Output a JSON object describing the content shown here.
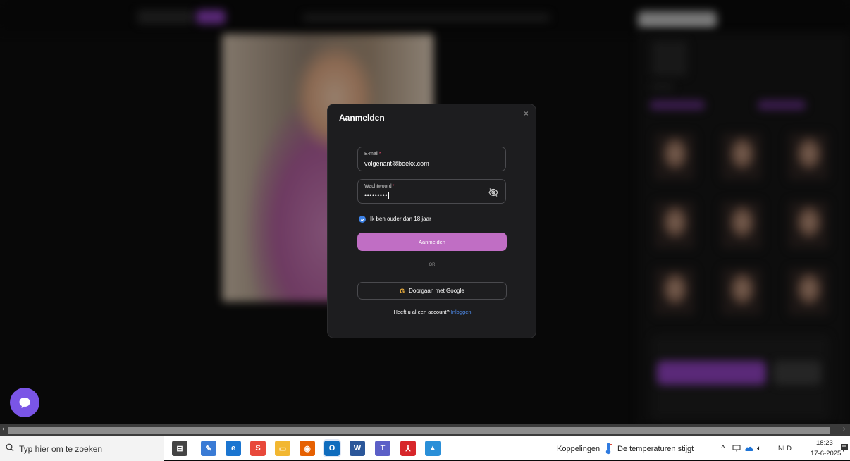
{
  "modal": {
    "title": "Aanmelden",
    "close_glyph": "×",
    "email_label": "E-mail",
    "email_required": "*",
    "email_value": "volgenant@boekx.com",
    "password_label": "Wachtwoord",
    "password_required": "*",
    "password_value": "•••••••••",
    "age_checkbox_label": "Ik ben ouder dan 18 jaar",
    "age_checkbox_checked": true,
    "submit_label": "Aanmelden",
    "divider_text": "OR",
    "google_button_label": "Doorgaan met Google",
    "google_icon_glyph": "G",
    "footer_question": "Heeft u al een account?",
    "footer_link": "Inloggen"
  },
  "taskbar": {
    "search_placeholder": "Typ hier om te zoeken",
    "apps": [
      {
        "name": "task-view-icon",
        "glyph": "⊟",
        "color": "#444444"
      },
      {
        "name": "paint-icon",
        "glyph": "✎",
        "color": "#3a7bd5"
      },
      {
        "name": "internet-explorer-icon",
        "glyph": "e",
        "color": "#1b75d0"
      },
      {
        "name": "s-app-icon",
        "glyph": "S",
        "color": "#e8483a"
      },
      {
        "name": "file-explorer-icon",
        "glyph": "▭",
        "color": "#f2b731"
      },
      {
        "name": "firefox-icon",
        "glyph": "◉",
        "color": "#e66000"
      },
      {
        "name": "outlook-icon",
        "glyph": "O",
        "color": "#0f6cbd"
      },
      {
        "name": "word-icon",
        "glyph": "W",
        "color": "#2b579a"
      },
      {
        "name": "teams-icon",
        "glyph": "T",
        "color": "#5b5fc7"
      },
      {
        "name": "acrobat-icon",
        "glyph": "⅄",
        "color": "#d7262a"
      },
      {
        "name": "photos-icon",
        "glyph": "▲",
        "color": "#2a8fd8"
      }
    ],
    "links_label": "Koppelingen",
    "weather_text": "De temperaturen stijgt",
    "language": "NLD",
    "time": "18:23",
    "date": "17-6-2025"
  },
  "colors": {
    "accent_button": "#c06ec4",
    "link": "#4f8ef0",
    "checkbox": "#3d82e6",
    "chat_bubble": "#7a55e6"
  }
}
